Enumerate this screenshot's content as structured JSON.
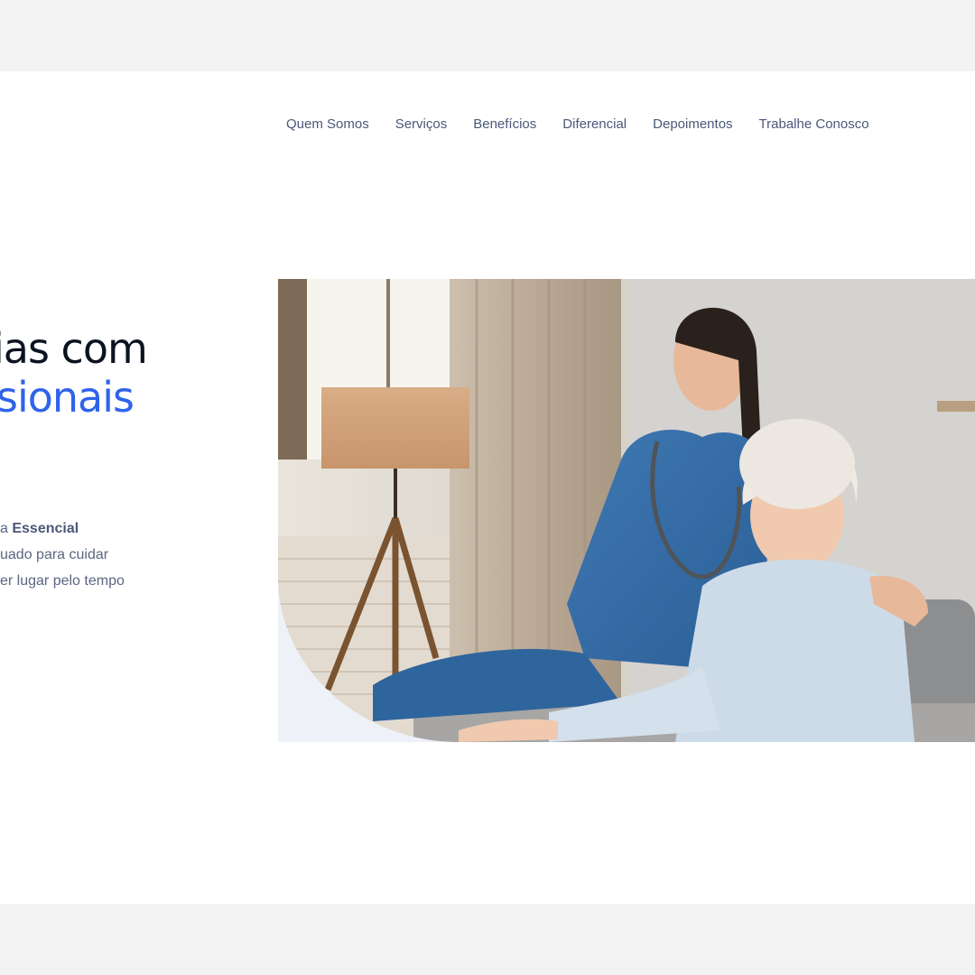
{
  "nav": {
    "items": [
      "Quem Somos",
      "Serviços",
      "Benefícios",
      "Diferencial",
      "Depoimentos",
      "Trabalhe Conosco"
    ]
  },
  "hero": {
    "title_line1": "ias com",
    "title_line2": "sionais",
    "desc_line1_prefix": "a ",
    "desc_line1_strong": "Essencial",
    "desc_line2": "uado para cuidar",
    "desc_line3": "er lugar pelo tempo"
  },
  "colors": {
    "accent": "#2f63ea",
    "nav_text": "#4a5878",
    "heading": "#0b1220",
    "background": "#f3f3f3"
  }
}
